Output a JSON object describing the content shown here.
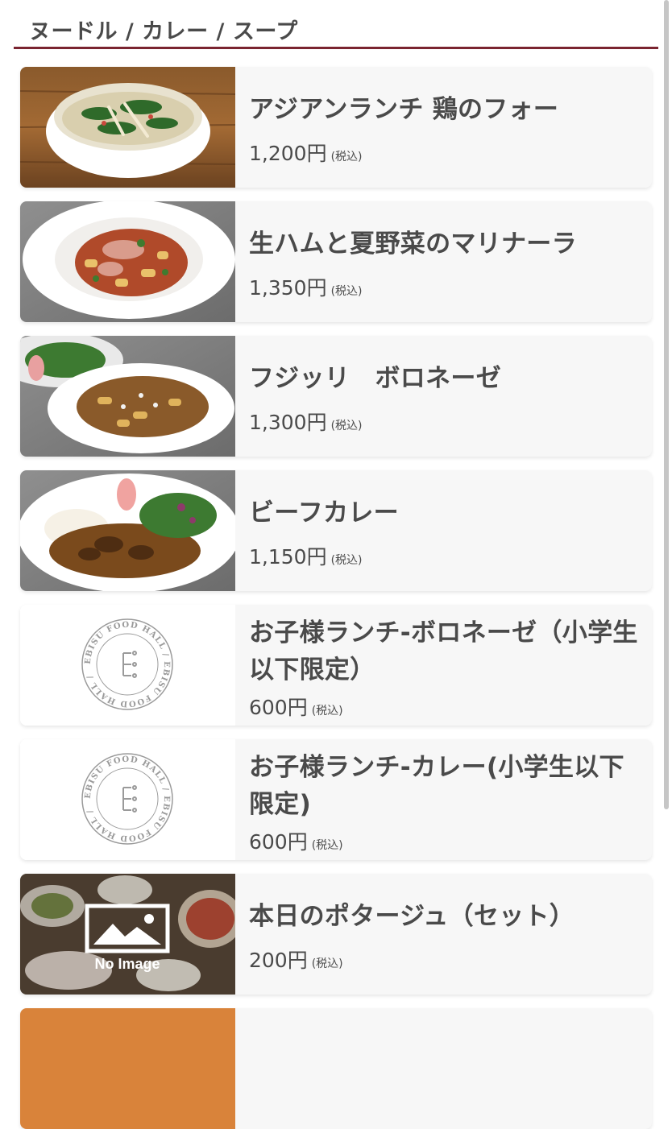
{
  "section": {
    "title": "ヌードル / カレー / スープ"
  },
  "logo": {
    "ring_text": "EBISU FOOD HALL / EBISU FOOD HALL /"
  },
  "no_image": {
    "label": "No Image"
  },
  "items": [
    {
      "name": "アジアンランチ 鶏のフォー",
      "price": "1,200円",
      "tax": "(税込)",
      "image": "chicken-pho-photo"
    },
    {
      "name": "生ハムと夏野菜のマリナーラ",
      "price": "1,350円",
      "tax": "(税込)",
      "image": "prosciutto-marinara-photo"
    },
    {
      "name": "フジッリ　ボロネーゼ",
      "price": "1,300円",
      "tax": "(税込)",
      "image": "fusilli-bolognese-photo"
    },
    {
      "name": "ビーフカレー",
      "price": "1,150円",
      "tax": "(税込)",
      "image": "beef-curry-photo"
    },
    {
      "name": "お子様ランチ-ボロネーゼ（小学生以下限定）",
      "price": "600円",
      "tax": "(税込)",
      "image": "ebisu-food-hall-logo"
    },
    {
      "name": "お子様ランチ-カレー(小学生以下限定)",
      "price": "600円",
      "tax": "(税込)",
      "image": "ebisu-food-hall-logo"
    },
    {
      "name": "本日のポタージュ（セット）",
      "price": "200円",
      "tax": "(税込)",
      "image": "no-image-placeholder"
    }
  ],
  "colors": {
    "accent_rule": "#7a2430",
    "card_bg": "#f7f7f7",
    "text": "#4a4a4a"
  }
}
